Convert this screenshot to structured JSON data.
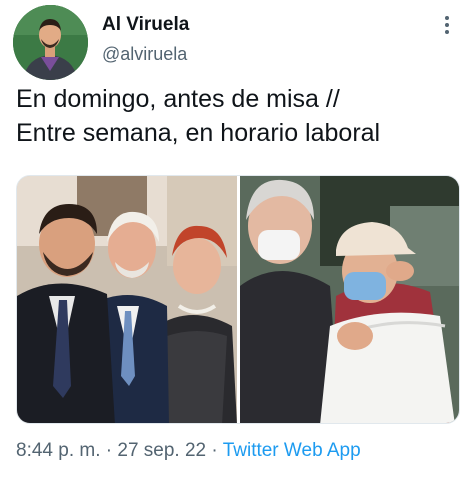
{
  "author": {
    "display_name": "Al Viruela",
    "handle": "@alviruela",
    "avatar_icon": "profile-photo"
  },
  "tweet": {
    "text": "En domingo, antes de misa  //\nEntre semana, en horario laboral",
    "time": "8:44 p. m.",
    "separator": "·",
    "date": "27 sep. 22",
    "source": "Twitter Web App"
  },
  "media": {
    "photos": [
      {
        "description_icon": "photo"
      },
      {
        "description_icon": "photo"
      }
    ]
  },
  "colors": {
    "link": "#1d9bf0",
    "secondary_text": "#536471",
    "primary_text": "#0f1419"
  }
}
